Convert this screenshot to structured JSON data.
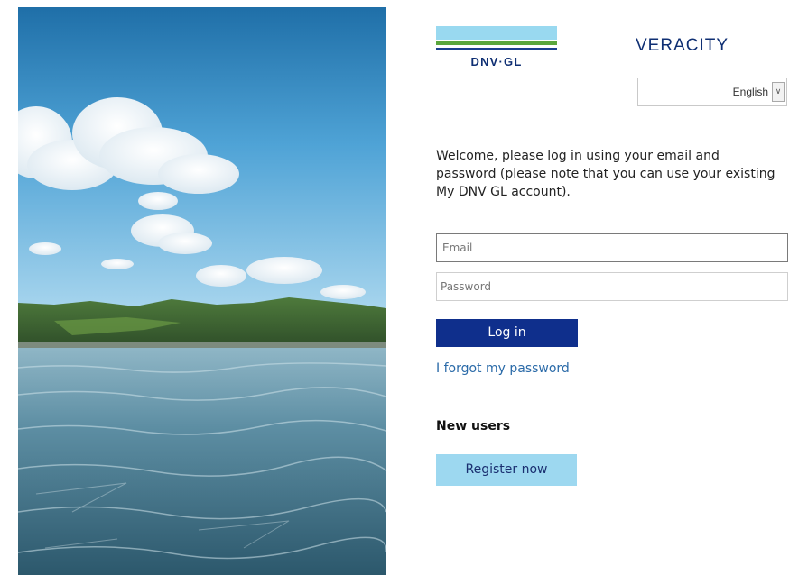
{
  "brand": {
    "logo_text": "DNV·GL",
    "product": "VERACITY"
  },
  "language": {
    "selected": "English",
    "arrow_icon": "chevron-down-icon"
  },
  "login": {
    "welcome": "Welcome, please log in using your email and password (please note that you can use your existing My DNV GL account).",
    "email_placeholder": "Email",
    "password_placeholder": "Password",
    "login_label": "Log in",
    "forgot_label": "I forgot my password"
  },
  "register": {
    "heading": "New users",
    "button_label": "Register now"
  },
  "colors": {
    "primary": "#0f2f8c",
    "secondary": "#9dd8f0",
    "link": "#2a6aa8",
    "logo_blue": "#99d9f0",
    "logo_green": "#5aa63c",
    "logo_navy": "#1b3f8f"
  }
}
